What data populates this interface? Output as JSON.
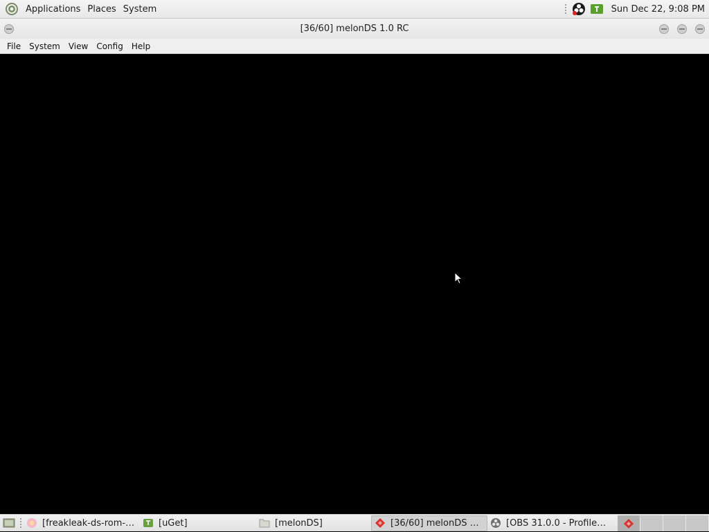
{
  "top_panel": {
    "menus": [
      {
        "label": "Applications"
      },
      {
        "label": "Places"
      },
      {
        "label": "System"
      }
    ],
    "tray_icons": [
      "obs-tray-icon",
      "uget-tray-icon"
    ],
    "clock": "Sun Dec 22,  9:08 PM"
  },
  "window": {
    "title": "[36/60] melonDS 1.0 RC",
    "menubar": [
      {
        "label": "File"
      },
      {
        "label": "System"
      },
      {
        "label": "View"
      },
      {
        "label": "Config"
      },
      {
        "label": "Help"
      }
    ]
  },
  "taskbar": {
    "tasks": [
      {
        "label": "[freakleak-ds-rom-…",
        "icon": "browser-icon",
        "active": false
      },
      {
        "label": "[uGet]",
        "icon": "uget-icon",
        "active": false
      },
      {
        "label": "[melonDS]",
        "icon": "folder-icon",
        "active": false
      },
      {
        "label": "[36/60] melonDS 1.…",
        "icon": "melonds-icon",
        "active": true
      },
      {
        "label": "[OBS 31.0.0 - Profile…",
        "icon": "obs-icon",
        "active": false
      }
    ],
    "workspaces": 4,
    "active_workspace": 1
  },
  "colors": {
    "panel_bg": "#eeeeee",
    "display_bg": "#000000",
    "melonds_red": "#d8342c",
    "uget_green": "#5aa02c"
  }
}
